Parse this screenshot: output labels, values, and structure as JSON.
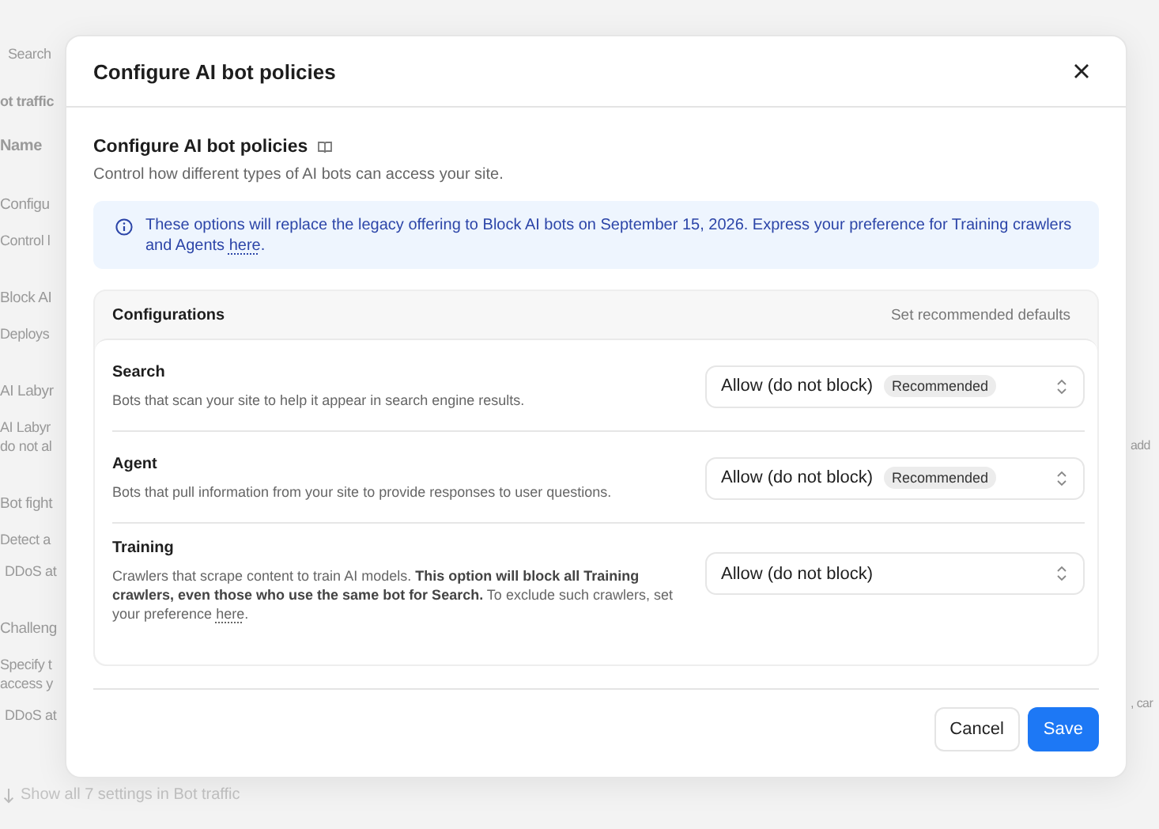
{
  "background": {
    "left_items": [
      {
        "kind": "search",
        "text": "Search"
      },
      {
        "kind": "section",
        "text": "ot traffic"
      },
      {
        "kind": "column",
        "text": "Name"
      },
      {
        "kind": "title",
        "text": "Configu"
      },
      {
        "kind": "desc",
        "text": "Control l"
      },
      {
        "kind": "title",
        "text": "Block AI"
      },
      {
        "kind": "desc",
        "text": "Deploys"
      },
      {
        "kind": "title",
        "text": "AI Labyr"
      },
      {
        "kind": "desc",
        "text": "AI Labyr"
      },
      {
        "kind": "desc",
        "text": "do not al"
      },
      {
        "kind": "title",
        "text": "Bot fight"
      },
      {
        "kind": "desc",
        "text": "Detect a"
      },
      {
        "kind": "chip",
        "text": "DDoS at"
      },
      {
        "kind": "title",
        "text": "Challeng"
      },
      {
        "kind": "desc",
        "text": "Specify t"
      },
      {
        "kind": "desc",
        "text": "access y"
      },
      {
        "kind": "chip",
        "text": "DDoS at"
      }
    ],
    "right_items": [
      "add",
      ", car"
    ],
    "show_all": "Show all 7 settings in Bot traffic"
  },
  "dialog": {
    "title": "Configure AI bot policies",
    "section_title": "Configure AI bot policies",
    "section_description": "Control how different types of AI bots can access your site.",
    "notice": {
      "text": "These options will replace the legacy offering to Block AI bots on September 15, 2026. Express your preference for Training crawlers and Agents",
      "link": "here",
      "suffix": "."
    },
    "configurations": {
      "title": "Configurations",
      "action": "Set recommended defaults",
      "rows": [
        {
          "name": "Search",
          "description": "Bots that scan your site to help it appear in search engine results.",
          "value": "Allow (do not block)",
          "badge": "Recommended"
        },
        {
          "name": "Agent",
          "description": "Bots that pull information from your site to provide responses to user questions.",
          "value": "Allow (do not block)",
          "badge": "Recommended"
        },
        {
          "name": "Training",
          "description": "Crawlers that scrape content to train AI models. **This option will block all Training crawlers, even those who use the same bot for Search.** To exclude such crawlers, set your preference",
          "link": "here",
          "suffix": ".",
          "value": "Allow (do not block)"
        }
      ]
    },
    "buttons": {
      "cancel": "Cancel",
      "save": "Save"
    }
  }
}
